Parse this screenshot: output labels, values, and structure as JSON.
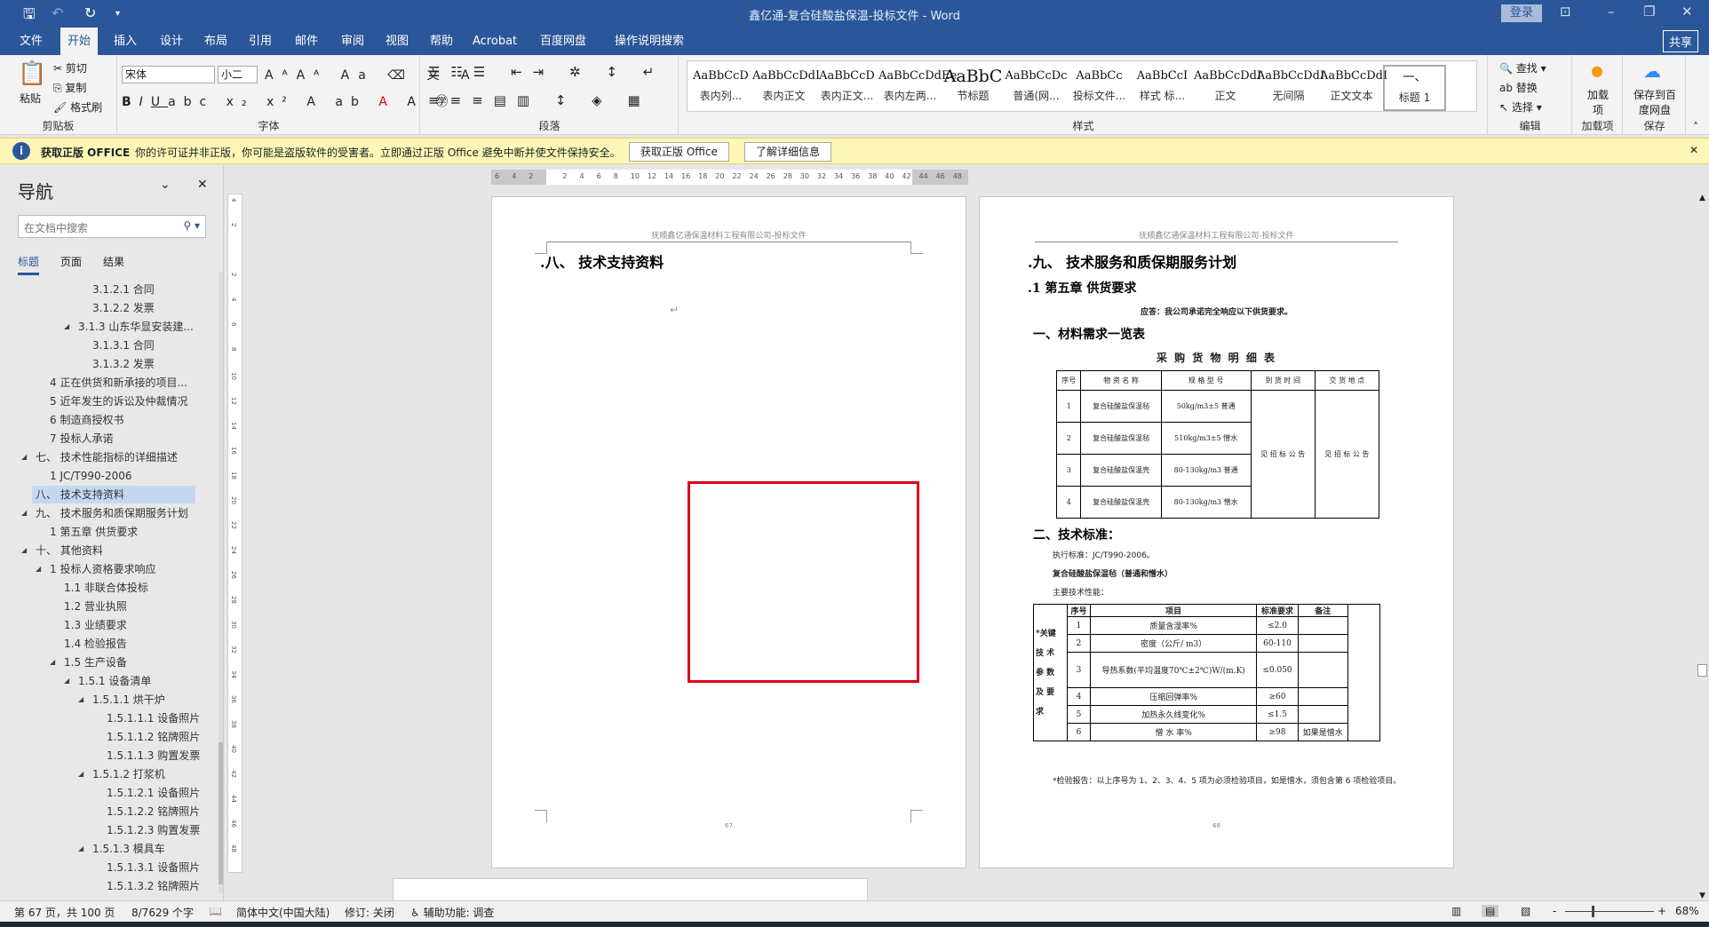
{
  "window": {
    "title": "鑫亿通-复合硅酸盐保温-投标文件  -  Word",
    "login": "登录",
    "share": "共享"
  },
  "tabs": [
    "文件",
    "开始",
    "插入",
    "设计",
    "布局",
    "引用",
    "邮件",
    "审阅",
    "视图",
    "帮助",
    "Acrobat",
    "百度网盘",
    "操作说明搜索"
  ],
  "ribbon": {
    "clipboard": {
      "label": "剪贴板",
      "paste": "粘贴",
      "cut": "剪切",
      "copy": "复制",
      "format_painter": "格式刷"
    },
    "font": {
      "label": "字体",
      "font_name": "宋体",
      "font_size": "小二"
    },
    "paragraph": {
      "label": "段落"
    },
    "styles": {
      "label": "样式",
      "items": [
        {
          "preview": "AaBbCcD",
          "name": "表内列..."
        },
        {
          "preview": "AaBbCcDdI",
          "name": "表内正文"
        },
        {
          "preview": "AaBbCcD",
          "name": "表内正文..."
        },
        {
          "preview": "AaBbCcDdEe",
          "name": "表内左两..."
        },
        {
          "preview": "AaBbC",
          "name": "节标题"
        },
        {
          "preview": "AaBbCcDc",
          "name": "普通(网..."
        },
        {
          "preview": "AaBbCc",
          "name": "投标文件..."
        },
        {
          "preview": "AaBbCcI",
          "name": "样式 标..."
        },
        {
          "preview": "AaBbCcDdI",
          "name": "正文"
        },
        {
          "preview": "AaBbCcDdI",
          "name": "无间隔"
        },
        {
          "preview": "AaBbCcDdI",
          "name": "正文文本"
        },
        {
          "preview": "一、",
          "name": "标题 1"
        }
      ]
    },
    "editing": {
      "label": "编辑",
      "find": "查找",
      "replace": "替换",
      "select": "选择"
    },
    "addins": {
      "label": "加载项",
      "button": "加载项"
    },
    "save": {
      "label": "保存",
      "button": "保存到百度网盘"
    }
  },
  "message_bar": {
    "title": "获取正版 OFFICE",
    "text": "你的许可证并非正版，你可能是盗版软件的受害者。立即通过正版 Office 避免中断并使文件保持安全。",
    "btn1": "获取正版 Office",
    "btn2": "了解详细信息"
  },
  "nav": {
    "title": "导航",
    "search_placeholder": "在文档中搜索",
    "tabs": [
      "标题",
      "页面",
      "结果"
    ],
    "items": [
      {
        "text": "3.1.2.1 合同",
        "level": 4
      },
      {
        "text": "3.1.2.2 发票",
        "level": 4
      },
      {
        "text": "3.1.3 山东华显安装建...",
        "level": 3,
        "exp": true
      },
      {
        "text": "3.1.3.1 合同",
        "level": 4
      },
      {
        "text": "3.1.3.2 发票",
        "level": 4
      },
      {
        "text": "4 正在供货和新承接的项目...",
        "level": 1
      },
      {
        "text": "5 近年发生的诉讼及仲裁情况",
        "level": 1
      },
      {
        "text": "6 制造商授权书",
        "level": 1
      },
      {
        "text": "7 投标人承诺",
        "level": 1
      },
      {
        "text": "七、 技术性能指标的详细描述",
        "level": 0,
        "exp": true
      },
      {
        "text": "1 JC/T990-2006",
        "level": 1
      },
      {
        "text": "八、 技术支持资料",
        "level": 0,
        "selected": true
      },
      {
        "text": "九、 技术服务和质保期服务计划",
        "level": 0,
        "exp": true
      },
      {
        "text": "1 第五章  供货要求",
        "level": 1
      },
      {
        "text": "十、 其他资料",
        "level": 0,
        "exp": true
      },
      {
        "text": "1 投标人资格要求响应",
        "level": 1,
        "exp": true
      },
      {
        "text": "1.1 非联合体投标",
        "level": 2
      },
      {
        "text": "1.2 营业执照",
        "level": 2
      },
      {
        "text": "1.3 业绩要求",
        "level": 2
      },
      {
        "text": "1.4 检验报告",
        "level": 2
      },
      {
        "text": "1.5 生产设备",
        "level": 2,
        "exp": true
      },
      {
        "text": "1.5.1 设备清单",
        "level": 3,
        "exp": true
      },
      {
        "text": "1.5.1.1 烘干炉",
        "level": 4,
        "exp": true
      },
      {
        "text": "1.5.1.1.1 设备照片",
        "level": 5
      },
      {
        "text": "1.5.1.1.2 铭牌照片",
        "level": 5
      },
      {
        "text": "1.5.1.1.3 购置发票",
        "level": 5
      },
      {
        "text": "1.5.1.2 打浆机",
        "level": 4,
        "exp": true
      },
      {
        "text": "1.5.1.2.1 设备照片",
        "level": 5
      },
      {
        "text": "1.5.1.2.2 铭牌照片",
        "level": 5
      },
      {
        "text": "1.5.1.2.3 购置发票",
        "level": 5
      },
      {
        "text": "1.5.1.3 模具车",
        "level": 4,
        "exp": true
      },
      {
        "text": "1.5.1.3.1 设备照片",
        "level": 5
      },
      {
        "text": "1.5.1.3.2 铭牌照片",
        "level": 5
      }
    ]
  },
  "ruler": {
    "h_ticks": [
      "6",
      "4",
      "2",
      "",
      "2",
      "4",
      "6",
      "8",
      "10",
      "12",
      "14",
      "16",
      "18",
      "20",
      "22",
      "24",
      "26",
      "28",
      "30",
      "32",
      "34",
      "36",
      "38",
      "40",
      "42",
      "44",
      "46",
      "48"
    ]
  },
  "page_left": {
    "header": "抚顺鑫亿通保温材料工程有限公司-投标文件",
    "heading": ".八、 技术支持资料",
    "page_no": "67"
  },
  "page_right": {
    "header": "抚顺鑫亿通保温材料工程有限公司-投标文件",
    "heading": ".九、 技术服务和质保期服务计划",
    "sub": ".1  第五章   供货要求",
    "reply": "应答：我公司承诺完全响应以下供货要求。",
    "sec1": "一、材料需求一览表",
    "table1_title": "采 购 货 物 明 细 表",
    "table1_head": [
      "序号",
      "物 资 名 称",
      "规 格 型 号",
      "到 货 时 间",
      "交 货 地 点"
    ],
    "table1_rows": [
      [
        "1",
        "复合硅酸盐保温毡",
        "50kg/m3±5 普通"
      ],
      [
        "2",
        "复合硅酸盐保温毡",
        "510kg/m3±5 憎水"
      ],
      [
        "3",
        "复合硅酸盐保温壳",
        "80-130kg/m3 普通"
      ],
      [
        "4",
        "复合硅酸盐保温壳",
        "80-130kg/m3 憎水"
      ]
    ],
    "table1_merged": [
      "见 招 标 公 告",
      "见 招 标 公 告"
    ],
    "sec2": "二、技术标准：",
    "std": "执行标准：JC/T990-2006。",
    "product": "复合硅酸盐保温毡（普通和憎水）",
    "perf": "主要技术性能：",
    "table2_side": "*关键 技 术 参 数 及 要 求",
    "table2_head": [
      "序号",
      "项目",
      "标准要求",
      "备注"
    ],
    "table2_rows": [
      [
        "1",
        "质量含湿率%",
        "≤2.0",
        ""
      ],
      [
        "2",
        "密度（公斤/ m3）",
        "60-110",
        ""
      ],
      [
        "3",
        "导热系数(平均温度70℃±2℃)W/(m.K)",
        "≤0.050",
        ""
      ],
      [
        "4",
        "压缩回弹率%",
        "≥60",
        ""
      ],
      [
        "5",
        "加热永久线变化%",
        "≤1.5",
        ""
      ],
      [
        "6",
        "憎 水 率%",
        "≥98",
        "如果是憎水"
      ]
    ],
    "note": "*检验报告：以上序号为 1、2、3、4、5 项为必须检验项目，如是憎水，须包含第 6 项检验项目。",
    "page_no": "68"
  },
  "status": {
    "page": "第 67 页，共 100 页",
    "words": "8/7629 个字",
    "language": "简体中文(中国大陆)",
    "track": "修订: 关闭",
    "accessibility": "辅助功能: 调查",
    "zoom": "68%"
  },
  "colors": {
    "accent": "#2b579a",
    "message_bar": "#fdf6b6",
    "selection_box": "#d9001b"
  }
}
